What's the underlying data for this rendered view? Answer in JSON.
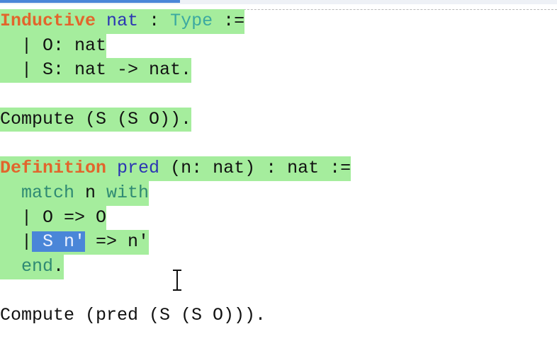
{
  "editor": {
    "lines": [
      {
        "p": [
          "Inductive",
          " ",
          "nat",
          " : ",
          "Type",
          " :="
        ]
      },
      {
        "p": [
          "  | O: nat"
        ]
      },
      {
        "p": [
          "  | S: nat -> nat."
        ]
      },
      {
        "p": [
          ""
        ]
      },
      {
        "p": [
          "Compute (S (S O))."
        ]
      },
      {
        "p": [
          ""
        ]
      },
      {
        "p": [
          "Definition",
          " ",
          "pred",
          " (n: nat) : nat :="
        ]
      },
      {
        "p": [
          "  ",
          "match",
          " n ",
          "with"
        ]
      },
      {
        "p": [
          "  | O => O"
        ]
      },
      {
        "p": [
          "  |",
          " S n'",
          " => n'"
        ]
      },
      {
        "p": [
          "  ",
          "end",
          "."
        ]
      },
      {
        "p": [
          ""
        ]
      },
      {
        "p": [
          "Compute (pred (S (S O)))."
        ]
      }
    ]
  },
  "colors": {
    "checked_highlight": "#a5ed9d",
    "keyword": "#e2652c",
    "identifier": "#2b35b3",
    "type": "#3ba9a0",
    "match_keyword": "#2f8a73",
    "selection": "#4a86d8"
  },
  "cursor": {
    "icon": "text-cursor-ibeam-icon"
  }
}
